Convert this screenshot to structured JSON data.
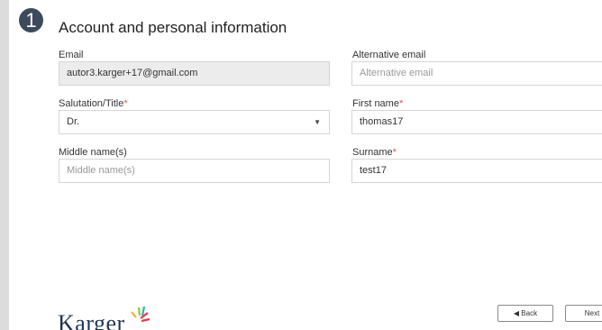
{
  "step": {
    "number": "1"
  },
  "section": {
    "title": "Account and personal information"
  },
  "fields": {
    "email": {
      "label": "Email",
      "value": "autor3.karger+17@gmail.com"
    },
    "alt_email": {
      "label": "Alternative email",
      "placeholder": "Alternative email"
    },
    "salutation": {
      "label": "Salutation/Title",
      "required_mark": "*",
      "value": "Dr."
    },
    "first_name": {
      "label": "First name",
      "required_mark": "*",
      "value": "thomas17"
    },
    "middle_name": {
      "label": "Middle name(s)",
      "placeholder": "Middle name(s)"
    },
    "surname": {
      "label": "Surname",
      "required_mark": "*",
      "value": "test17"
    }
  },
  "nav": {
    "back_label": "◀ Back",
    "next_label": "Next"
  },
  "brand": {
    "name": "Karger"
  },
  "colors": {
    "badge": "#3d4a5c",
    "required": "#d9534f",
    "readonly_bg": "#ececec"
  }
}
